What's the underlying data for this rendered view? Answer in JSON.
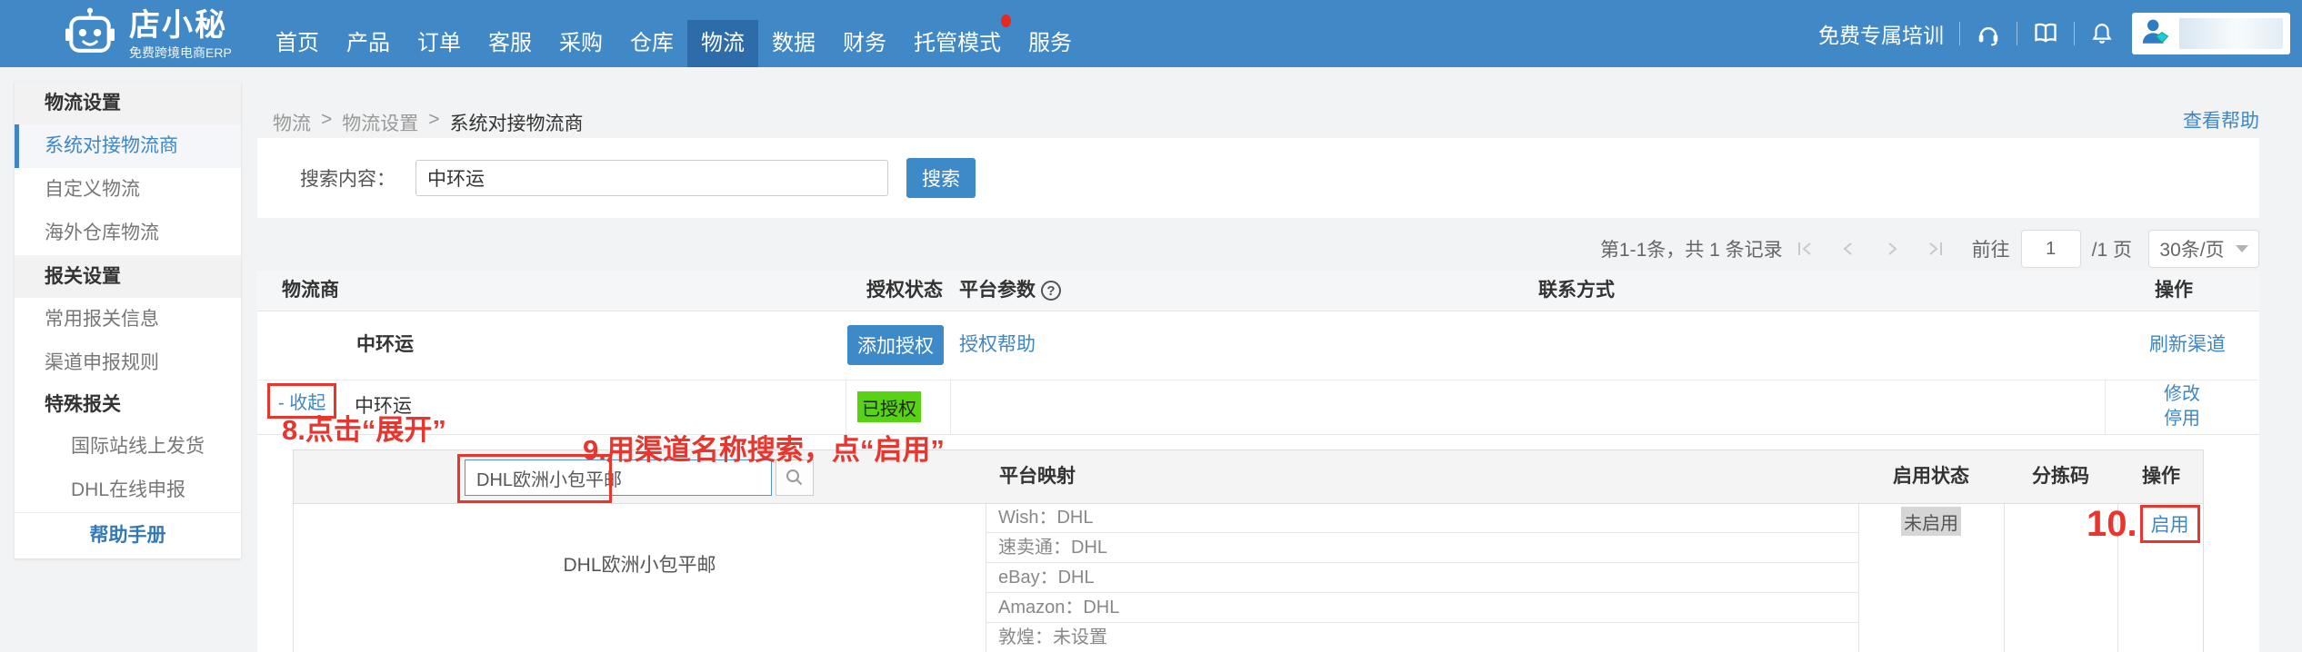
{
  "colors": {
    "accent_blue": "#3e86c4",
    "navbar_blue": "#4189c6",
    "navbar_active": "#2d6ca8",
    "button_blue": "#3e8ac8",
    "authorized_green": "#58d313",
    "annotation_red": "#e8352e"
  },
  "navbar": {
    "brand": {
      "title": "店小秘",
      "subtitle": "免费跨境电商ERP"
    },
    "items": [
      {
        "label": "首页"
      },
      {
        "label": "产品"
      },
      {
        "label": "订单"
      },
      {
        "label": "客服"
      },
      {
        "label": "采购"
      },
      {
        "label": "仓库"
      },
      {
        "label": "物流"
      },
      {
        "label": "数据"
      },
      {
        "label": "财务"
      },
      {
        "label": "托管模式"
      },
      {
        "label": "服务"
      }
    ],
    "active_item": "物流",
    "training_label": "免费专属培训"
  },
  "sidebar": {
    "items": [
      {
        "type": "header",
        "label": "物流设置"
      },
      {
        "type": "item",
        "label": "系统对接物流商",
        "selected": true
      },
      {
        "type": "item",
        "label": "自定义物流"
      },
      {
        "type": "item",
        "label": "海外仓库物流"
      },
      {
        "type": "header",
        "label": "报关设置"
      },
      {
        "type": "item",
        "label": "常用报关信息"
      },
      {
        "type": "item",
        "label": "渠道申报规则"
      },
      {
        "type": "subheader",
        "label": "特殊报关"
      },
      {
        "type": "subitem",
        "label": "国际站线上发货"
      },
      {
        "type": "subitem",
        "label": "DHL在线申报"
      },
      {
        "type": "help",
        "label": "帮助手册"
      }
    ]
  },
  "breadcrumb": {
    "items": [
      "物流",
      "物流设置",
      "系统对接物流商"
    ],
    "separator": ">"
  },
  "help_link": "查看帮助",
  "search_bar": {
    "label": "搜索内容：",
    "value": "中环运",
    "button": "搜索"
  },
  "pagination": {
    "summary": "第1-1条，共 1 条记录",
    "goto_label": "前往",
    "page_value": "1",
    "page_total": "/1 页",
    "page_size": "30条/页"
  },
  "provider_table": {
    "headers": {
      "provider": "物流商",
      "auth_status": "授权状态",
      "platform_params": "平台参数",
      "contact": "联系方式",
      "actions": "操作"
    },
    "params_help_glyph": "?",
    "row": {
      "name": "中环运",
      "add_auth": "添加授权",
      "auth_help": "授权帮助",
      "refresh": "刷新渠道"
    },
    "expanded": {
      "collapse": "- 收起",
      "name": "中环运",
      "status": "已授权",
      "modify": "修改",
      "disable": "停用"
    }
  },
  "annotations": {
    "step8": "8.点击“展开”",
    "step9": "9.用渠道名称搜索，点“启用”",
    "step10": "10."
  },
  "channel_table": {
    "search_value": "DHL欧洲小包平邮",
    "headers": {
      "mapping": "平台映射",
      "enable_status": "启用状态",
      "sort_code": "分拣码",
      "actions": "操作"
    },
    "row": {
      "name": "DHL欧洲小包平邮",
      "mappings": [
        "Wish：DHL",
        "速卖通：DHL",
        "eBay：DHL",
        "Amazon：DHL",
        "敦煌：未设置"
      ],
      "status": "未启用",
      "enable": "启用"
    }
  }
}
